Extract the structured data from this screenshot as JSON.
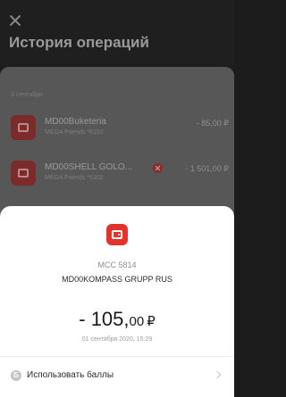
{
  "header": {
    "title": "История операций"
  },
  "list": {
    "date_label": "3 сентября",
    "items": [
      {
        "name": "MD00Buketeria",
        "card": "MEGA Friends *6102",
        "amount": "- 85,00 ₽"
      },
      {
        "name": "MD00SHELL GOLO...",
        "card": "MEGA Friends *6102",
        "amount": "- 1 501,00 ₽",
        "status_icon": "error-icon"
      }
    ]
  },
  "sheet": {
    "icon": "wallet-icon",
    "mcc": "MCC 5814",
    "merchant": "MD00KOMPASS GRUPP RUS",
    "amount_int": "- 105,",
    "amount_dec": "00",
    "currency": "₽",
    "datetime": "01 сентября 2020, 15:29",
    "action_label": "Использовать баллы",
    "action_icon_letter": "Б"
  },
  "colors": {
    "accent": "#e2332a",
    "sheet_bg": "#ffffff",
    "overlay": "#575757"
  }
}
